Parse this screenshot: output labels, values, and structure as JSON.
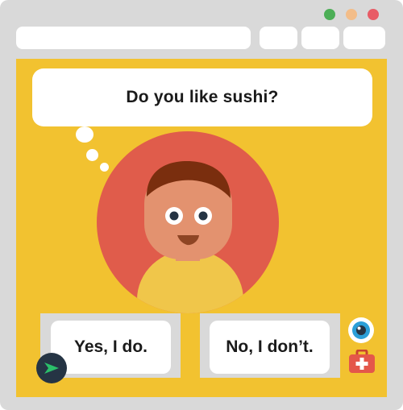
{
  "window": {
    "controls": [
      {
        "name": "maximize-dot",
        "color": "#4cae56"
      },
      {
        "name": "minimize-dot",
        "color": "#f3bd89"
      },
      {
        "name": "close-dot",
        "color": "#e85c66"
      }
    ]
  },
  "prompt": {
    "question": "Do you like sushi?"
  },
  "answers": {
    "yes_label": "Yes, I do.",
    "no_label": "No, I don’t."
  },
  "icons": {
    "view": "eye-icon",
    "help": "first-aid-kit-icon",
    "send": "send-icon"
  },
  "colors": {
    "window_chrome": "#d9d9d9",
    "content_bg": "#f2c230",
    "avatar_circle": "#e05c4b",
    "send_badge": "#253444",
    "send_arrow": "#2bbf6a"
  }
}
